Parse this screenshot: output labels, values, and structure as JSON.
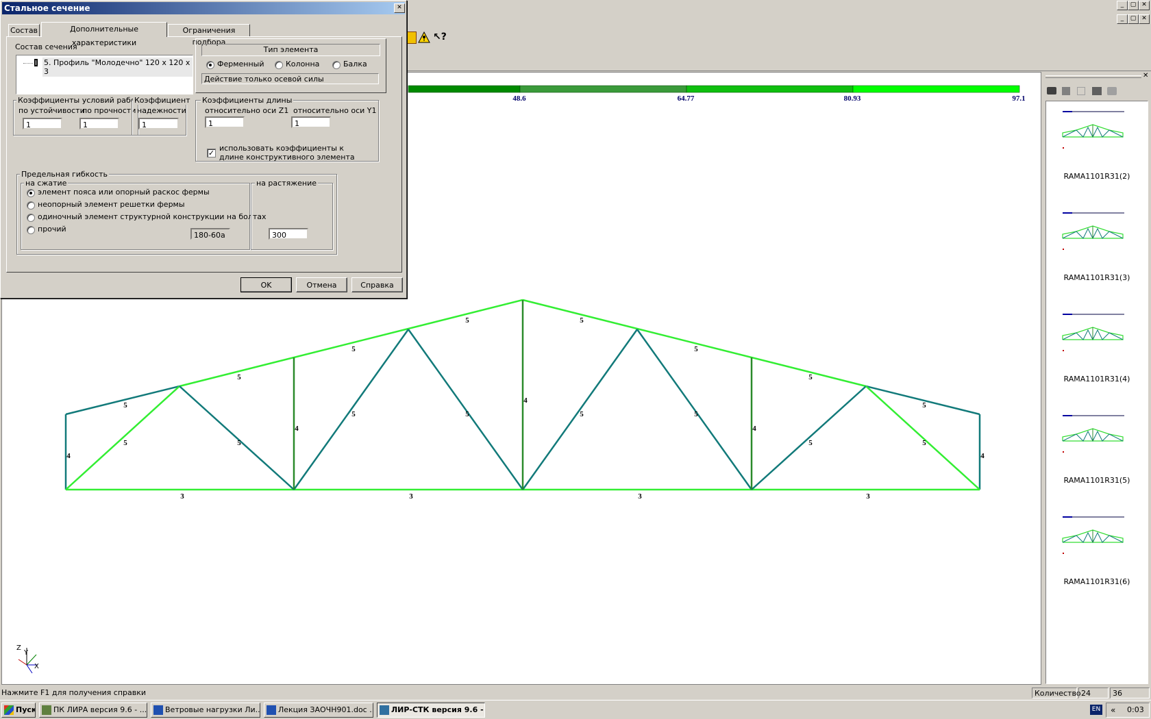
{
  "main_window": {
    "controls_top": [
      "_",
      "▢",
      "✕"
    ],
    "controls_second": [
      "_",
      "▢",
      "✕"
    ]
  },
  "scale": {
    "colors": [
      "#008a00",
      "#3a9a3a",
      "#0fbf0f",
      "#00ff00"
    ],
    "labels": [
      "48.6",
      "64.77",
      "80.93",
      "97.1"
    ]
  },
  "truss": {
    "top_chord_color": "#33ee33",
    "teal_color": "#127a7a",
    "dark_green_color": "#2a8a2a",
    "bottom_chord_color": "#33ee33",
    "labels": {
      "top": [
        "5",
        "5",
        "5",
        "5",
        "5",
        "5",
        "5",
        "5"
      ],
      "diag": [
        "5",
        "5",
        "5",
        "5",
        "5",
        "5",
        "5",
        "5"
      ],
      "vert": [
        "4",
        "4",
        "4",
        "4",
        "4"
      ],
      "bottom": [
        "3",
        "3",
        "3",
        "3"
      ]
    }
  },
  "axes": {
    "z": "Z",
    "y": "Y",
    "x": "X"
  },
  "right_panel": {
    "close": "✕",
    "thumbnails": [
      "RAMA1101R31(2)",
      "RAMA1101R31(3)",
      "RAMA1101R31(4)",
      "RAMA1101R31(5)",
      "RAMA1101R31(6)"
    ]
  },
  "dialog": {
    "title": "Стальное сечение",
    "close": "✕",
    "tabs": [
      "Состав",
      "Дополнительные характеристики",
      "Ограничения подбора"
    ],
    "composition_label": "Состав сечения",
    "composition_item": "5. Профиль \"Молодечно\" 120 х 120 х 3",
    "element_type": {
      "title": "Тип элемента",
      "options": [
        "Ферменный",
        "Колонна",
        "Балка"
      ],
      "selected": 0,
      "note": "Действие только осевой силы"
    },
    "coef_work": {
      "title": "Коэффициенты условий работы",
      "stability": "по устойчивости",
      "strength": "по прочности",
      "stability_value": "1",
      "strength_value": "1"
    },
    "coef_reliability": {
      "title": "Коэффициент",
      "subtitle": "надежности",
      "value": "1"
    },
    "coef_length": {
      "title": "Коэффициенты длины",
      "z1": "относительно оси Z1",
      "y1": "относительно оси Y1",
      "z1_value": "1",
      "y1_value": "1",
      "use_label": "использовать коэффициенты к длине конструктивного элемента",
      "use_checked": "✓"
    },
    "slenderness": {
      "title": "Предельная гибкость",
      "compression": "на сжатие",
      "tension": "на растяжение",
      "options": [
        "элемент пояса или опорный раскос фермы",
        "неопорный элемент решетки фермы",
        "одиночный элемент структурной конструкции на болтах",
        "прочий"
      ],
      "selected": 0,
      "compression_value": "180-60a",
      "tension_value": "300"
    },
    "buttons": {
      "ok": "OK",
      "cancel": "Отмена",
      "help": "Справка"
    }
  },
  "status_bar": {
    "hint": "Нажмите F1 для получения справки",
    "count_label": "Количество",
    "count_value_1": "24",
    "count_value_2": "36"
  },
  "taskbar": {
    "start": "Пуск",
    "buttons": [
      "ПК ЛИРА  версия 9.6 - ...",
      "Ветровые нагрузки Ли...",
      "Лекция ЗАОЧН901.doc ...",
      "ЛИР-СТК версия 9.6 - ..."
    ],
    "lang": "EN",
    "chevron": "«",
    "time": "0:03"
  }
}
